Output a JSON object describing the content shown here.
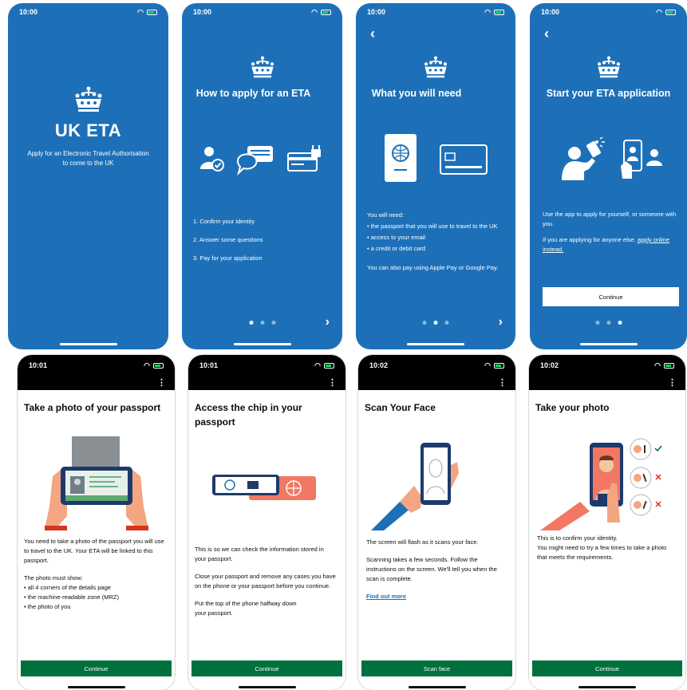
{
  "status": {
    "time_top": "10:00",
    "time_b1": "10:01",
    "time_b2": "10:01",
    "time_b3": "10:02",
    "time_b4": "10:02"
  },
  "screen1": {
    "title": "UK ETA",
    "subtitle": "Apply for an Electronic Travel Authorisation to come to the UK"
  },
  "screen2": {
    "title": "How to apply for an ETA",
    "steps": [
      "1. Confirm your identity",
      "2. Answer some questions",
      "3. Pay for your application"
    ]
  },
  "screen3": {
    "title": "What you will need",
    "intro": "You will need:",
    "items": [
      "the passport that you will use to travel to the UK",
      "access to your email",
      "a credit or debit card"
    ],
    "footer": "You can also pay using Apple Pay or Google Pay."
  },
  "screen4": {
    "title": "Start your ETA application",
    "para1": "Use the app to apply for yourself, or someone with you.",
    "para2_prefix": "If you are applying for anyone else, ",
    "para2_link": "apply online instead.",
    "button": "Continue"
  },
  "screen5": {
    "title": "Take a photo of your passport",
    "para1": "You need to take a photo of the passport you will use to travel to the UK. Your ETA will be linked to this passport.",
    "para2": "The photo must show:",
    "items": [
      "all 4 corners of the details page",
      "the machine-readable zone (MRZ)",
      "the photo of you"
    ],
    "button": "Continue"
  },
  "screen6": {
    "title": "Access the chip in your passport",
    "para1": "This is so we can check the information stored in your passport.",
    "para2": "Close your passport and remove any cases you have on the phone or your passport before you continue.",
    "para3": "Put the top of the phone halfway down your passport.",
    "button": "Continue"
  },
  "screen7": {
    "title": "Scan Your Face",
    "para1": "The screen will flash as it scans your face.",
    "para2": "Scanning takes a few seconds. Follow the instructions on the screen. We'll tell you when the scan is complete.",
    "link": "Find out more",
    "button": "Scan face"
  },
  "screen8": {
    "title": "Take your photo",
    "para1": "This is to confirm your identity.",
    "para2": "You might need to try a few times to take a photo that meets the requirements.",
    "button": "Continue"
  },
  "icons": [
    "crown-icon",
    "identity-check-icon",
    "speech-bubbles-icon",
    "locked-card-icon",
    "passport-icon",
    "credit-card-icon",
    "selfie-person-icon",
    "phone-person-icon",
    "chevron-right-icon",
    "back-arrow-icon",
    "menu-dots-icon",
    "wifi-icon",
    "battery-icon"
  ],
  "colors": {
    "gov_blue": "#1d70b8",
    "button_green": "#00703c",
    "passport_red": "#d4351c"
  }
}
